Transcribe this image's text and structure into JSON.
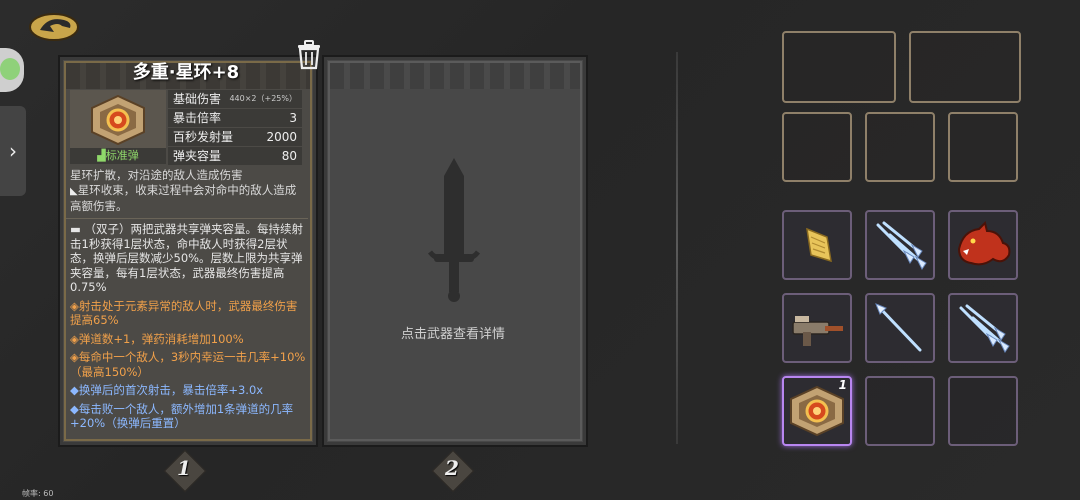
{
  "weapon": {
    "name": "多重·星环+8",
    "type_label": "标准弹",
    "stats": [
      {
        "label": "基础伤害",
        "value": "440×2（+25%）"
      },
      {
        "label": "暴击倍率",
        "value": "3"
      },
      {
        "label": "百秒发射量",
        "value": "2000"
      },
      {
        "label": "弹夹容量",
        "value": "80"
      }
    ],
    "desc1": "星环扩散，对沿途的敌人造成伤害",
    "desc2": "星环收束，收束过程中会对命中的敌人造成高额伤害。",
    "effects": [
      {
        "text": "（双子）两把武器共享弹夹容量。每持续射击1秒获得1层状态，命中敌人时获得2层状态，换弹后层数减少50%。层数上限为共享弹夹容量，每有1层状态，武器最终伤害提高0.75%",
        "color": "white"
      },
      {
        "text": "◈射击处于元素异常的敌人时，武器最终伤害提高65%",
        "color": "orange"
      },
      {
        "text": "◈弹道数+1，弹药消耗增加100%",
        "color": "orange"
      },
      {
        "text": "◈每命中一个敌人，3秒内幸运一击几率+10%（最高150%）",
        "color": "orange"
      },
      {
        "text": "◆换弹后的首次射击，暴击倍率+3.0x",
        "color": "blue"
      },
      {
        "text": "◆每击败一个敌人，额外增加1条弹道的几率+20%（换弹后重置）",
        "color": "blue"
      }
    ]
  },
  "slot2": {
    "hint": "点击武器查看详情"
  },
  "slot_numbers": [
    "1",
    "2"
  ],
  "inventory": {
    "selected_count": "1"
  },
  "fps_label": "帧率: 60",
  "colors": {
    "accent_purple": "#b886f0",
    "gold_border": "#8f8069",
    "orange_effect": "#f0a04a",
    "blue_effect": "#8cb8ff",
    "type_green": "#8fd86a"
  }
}
